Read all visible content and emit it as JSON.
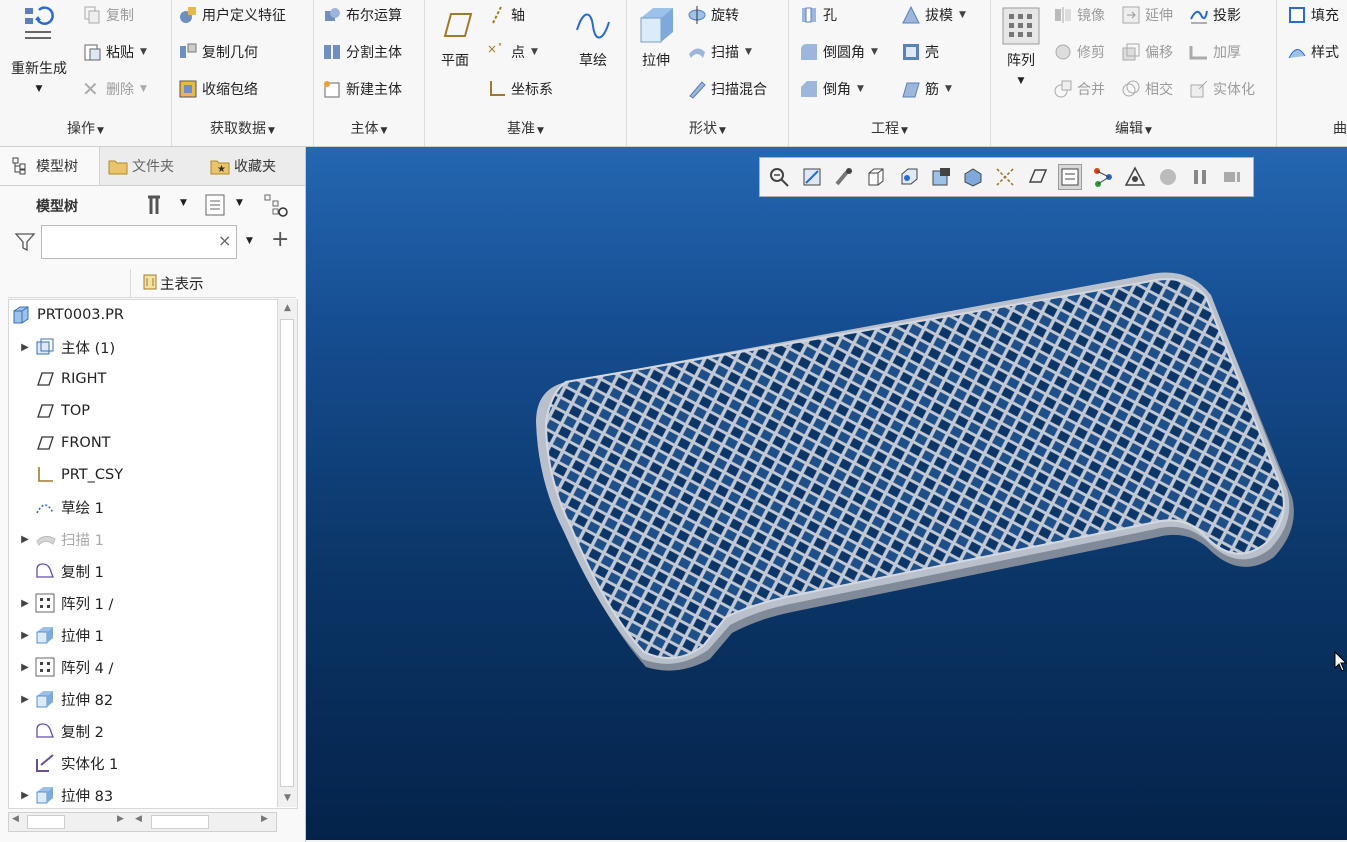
{
  "ribbon": {
    "operations": {
      "regenerate": "重新生成",
      "copy": "复制",
      "paste": "粘贴",
      "delete": "删除",
      "group": "操作"
    },
    "get_data": {
      "udf": "用户定义特征",
      "copy_geom": "复制几何",
      "shrinkwrap": "收缩包络",
      "group": "获取数据"
    },
    "body": {
      "boolean": "布尔运算",
      "split": "分割主体",
      "new": "新建主体",
      "group": "主体"
    },
    "datum": {
      "plane": "平面",
      "axis": "轴",
      "point": "点",
      "csys": "坐标系",
      "sketch": "草绘",
      "group": "基准"
    },
    "shapes": {
      "extrude": "拉伸",
      "revolve": "旋转",
      "sweep": "扫描",
      "swept_blend": "扫描混合",
      "group": "形状"
    },
    "engineering": {
      "hole": "孔",
      "draft": "拔模",
      "round": "倒圆角",
      "shell": "壳",
      "chamfer": "倒角",
      "rib": "筋",
      "group": "工程"
    },
    "editing": {
      "pattern": "阵列",
      "mirror": "镜像",
      "extend": "延伸",
      "project": "投影",
      "trim": "修剪",
      "offset": "偏移",
      "thicken": "加厚",
      "merge": "合并",
      "intersect": "相交",
      "solidify": "实体化",
      "group": "编辑"
    },
    "surfaces": {
      "fill": "填充",
      "style": "样式",
      "group": "曲"
    }
  },
  "panel": {
    "tabs": [
      "模型树",
      "文件夹",
      "收藏夹"
    ],
    "title": "模型树",
    "search_placeholder": "",
    "column_header": "主表示",
    "tree": [
      {
        "label": "PRT0003.PR",
        "icon": "part-icon",
        "expandable": false,
        "indent": 0
      },
      {
        "label": "主体 (1)",
        "icon": "body-icon",
        "expandable": true,
        "indent": 1
      },
      {
        "label": "RIGHT",
        "icon": "datum-plane-icon",
        "expandable": false,
        "indent": 1
      },
      {
        "label": "TOP",
        "icon": "datum-plane-icon",
        "expandable": false,
        "indent": 1
      },
      {
        "label": "FRONT",
        "icon": "datum-plane-icon",
        "expandable": false,
        "indent": 1
      },
      {
        "label": "PRT_CSY",
        "icon": "csys-icon",
        "expandable": false,
        "indent": 1
      },
      {
        "label": "草绘 1",
        "icon": "sketch-icon",
        "expandable": false,
        "indent": 1
      },
      {
        "label": "扫描 1",
        "icon": "sweep-icon",
        "expandable": true,
        "indent": 1,
        "disabled": true
      },
      {
        "label": "复制 1",
        "icon": "copy-geom-icon",
        "expandable": false,
        "indent": 1
      },
      {
        "label": "阵列 1 /",
        "icon": "pattern-icon",
        "expandable": true,
        "indent": 1
      },
      {
        "label": "拉伸 1",
        "icon": "extrude-icon",
        "expandable": true,
        "indent": 1
      },
      {
        "label": "阵列 4 /",
        "icon": "pattern-icon",
        "expandable": true,
        "indent": 1
      },
      {
        "label": "拉伸 82",
        "icon": "extrude-icon",
        "expandable": true,
        "indent": 1
      },
      {
        "label": "复制 2",
        "icon": "copy-geom-icon",
        "expandable": false,
        "indent": 1
      },
      {
        "label": "实体化 1",
        "icon": "solidify-icon",
        "expandable": false,
        "indent": 1
      },
      {
        "label": "拉伸 83",
        "icon": "extrude-icon",
        "expandable": true,
        "indent": 1
      }
    ]
  },
  "view_toolbar": [
    "zoom-icon",
    "refit-icon",
    "repaint-icon",
    "saved-orientations-icon",
    "view-manager-icon",
    "display-style-icon",
    "perspective-icon",
    "datum-display-icon",
    "annotation-display-icon",
    "spin-center-icon",
    "sketch-view-icon",
    "section-icon",
    "appearance-icon",
    "pause-icon",
    "hidden-icon"
  ],
  "colors": {
    "viewport_top": "#2467b2",
    "viewport_bottom": "#04234a",
    "part": "#b9c0cc"
  }
}
